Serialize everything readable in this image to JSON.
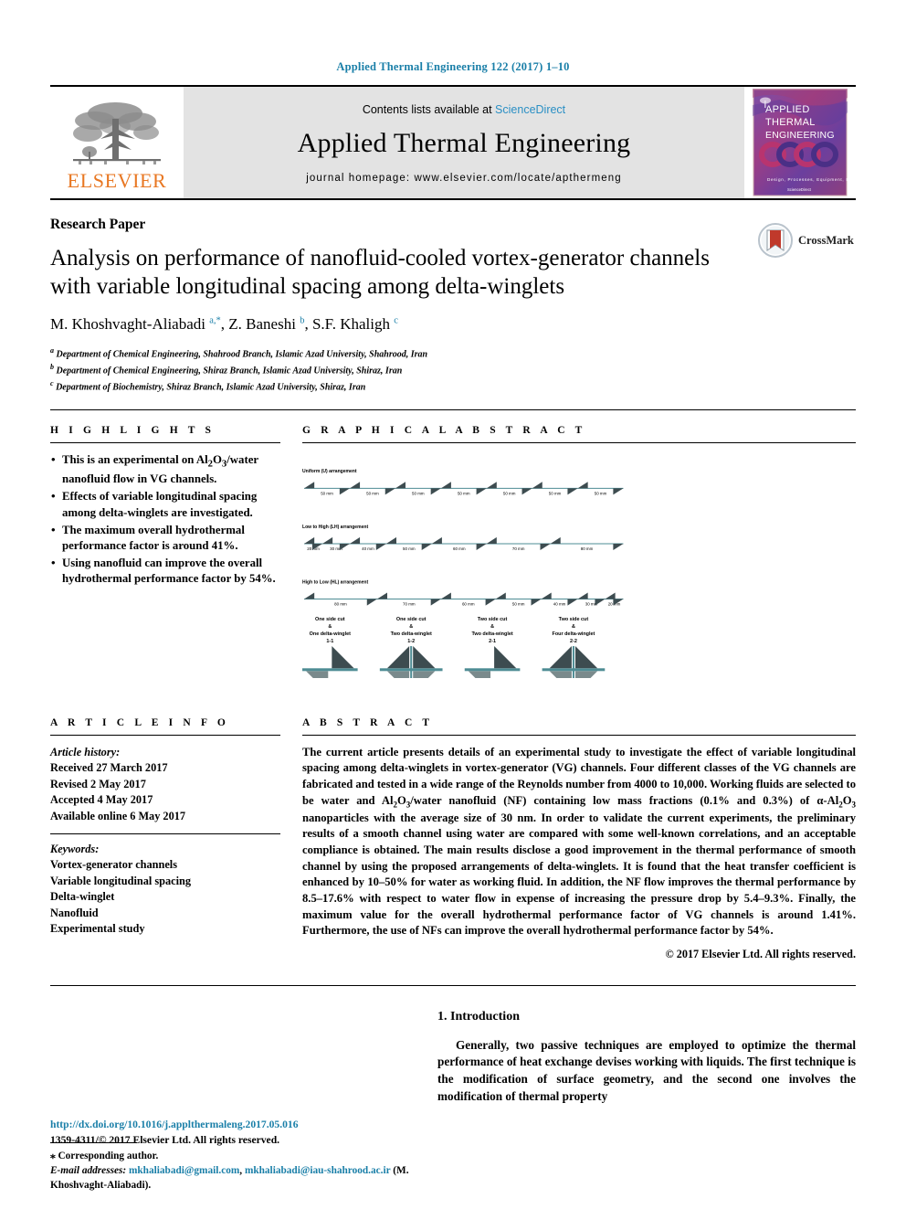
{
  "running_head": "Applied Thermal Engineering 122 (2017) 1–10",
  "masthead": {
    "publisher_name": "ELSEVIER",
    "publisher_logo_icon": "elsevier-tree-icon",
    "contents_prefix": "Contents lists available at ",
    "contents_link": "ScienceDirect",
    "journal_title": "Applied Thermal Engineering",
    "homepage": "journal homepage: www.elsevier.com/locate/apthermeng",
    "cover": {
      "line1": "APPLIED",
      "line2": "THERMAL",
      "line3": "ENGINEERING",
      "tagline": "Design, Processes, Equipment, Economics"
    }
  },
  "article": {
    "type": "Research Paper",
    "title": "Analysis on performance of nanofluid-cooled vortex-generator channels with variable longitudinal spacing among delta-winglets",
    "authors_html": "M. Khoshvaght-Aliabadi <sup>a,</sup><sup>*</sup>, Z. Baneshi <sup>b</sup>, S.F. Khaligh <sup>c</sup>",
    "affiliations": [
      "Department of Chemical Engineering, Shahrood Branch, Islamic Azad University, Shahrood, Iran",
      "Department of Chemical Engineering, Shiraz Branch, Islamic Azad University, Shiraz, Iran",
      "Department of Biochemistry, Shiraz Branch, Islamic Azad University, Shiraz, Iran"
    ],
    "affil_marks": [
      "a",
      "b",
      "c"
    ],
    "crossmark_label": "CrossMark",
    "crossmark_icon": "crossmark-icon"
  },
  "highlights": {
    "heading": "H I G H L I G H T S",
    "items": [
      "This is an experimental on Al2O3/water nanofluid flow in VG channels.",
      "Effects of variable longitudinal spacing among delta-winglets are investigated.",
      "The maximum overall hydrothermal performance factor is around 41%.",
      "Using nanofluid can improve the overall hydrothermal performance factor by 54%."
    ]
  },
  "graphical_abstract": {
    "heading": "G R A P H I C A L   A B S T R A C T",
    "rows": [
      {
        "label": "Uniform (U) arrangement",
        "spacings": [
          "50 mm",
          "50 mm",
          "50 mm",
          "50 mm",
          "50 mm",
          "50 mm",
          "50 mm"
        ]
      },
      {
        "label": "Low to High (LH) arrangement",
        "spacings": [
          "20 mm",
          "30 mm",
          "40 mm",
          "50 mm",
          "60 mm",
          "70 mm",
          "80 mm"
        ]
      },
      {
        "label": "High to Low (HL) arrangement",
        "spacings": [
          "80 mm",
          "70 mm",
          "60 mm",
          "50 mm",
          "40 mm",
          "30 mm",
          "20 mm"
        ]
      }
    ],
    "classes": [
      {
        "l1": "One side cut",
        "amp": "&",
        "l2": "One delta-winglet",
        "code": "1-1",
        "type": "1-1"
      },
      {
        "l1": "One side cut",
        "amp": "&",
        "l2": "Two delta-winglet",
        "code": "1-2",
        "type": "1-2"
      },
      {
        "l1": "Two side cut",
        "amp": "&",
        "l2": "Two delta-winglet",
        "code": "2-1",
        "type": "2-1"
      },
      {
        "l1": "Two side cut",
        "amp": "&",
        "l2": "Four delta-winglet",
        "code": "2-2",
        "type": "2-2"
      }
    ],
    "accent_color": "#4e8c94",
    "winglet_dark": "#3d4c50",
    "winglet_light": "#7a8a8c"
  },
  "article_info": {
    "heading": "A R T I C L E   I N F O",
    "history_label": "Article history:",
    "history": [
      "Received 27 March 2017",
      "Revised 2 May 2017",
      "Accepted 4 May 2017",
      "Available online 6 May 2017"
    ],
    "keywords_label": "Keywords:",
    "keywords": [
      "Vortex-generator channels",
      "Variable longitudinal spacing",
      "Delta-winglet",
      "Nanofluid",
      "Experimental study"
    ]
  },
  "abstract": {
    "heading": "A B S T R A C T",
    "paragraphs": [
      "The current article presents details of an experimental study to investigate the effect of variable longitudinal spacing among delta-winglets in vortex-generator (VG) channels. Four different classes of the VG channels are fabricated and tested in a wide range of the Reynolds number from 4000 to 10,000. Working fluids are selected to be water and Al2O3/water nanofluid (NF) containing low mass fractions (0.1% and 0.3%) of α-Al2O3 nanoparticles with the average size of 30 nm. In order to validate the current experiments, the preliminary results of a smooth channel using water are compared with some well-known correlations, and an acceptable compliance is obtained. The main results disclose a good improvement in the thermal performance of smooth channel by using the proposed arrangements of delta-winglets. It is found that the heat transfer coefficient is enhanced by 10–50% for water as working fluid. In addition, the NF flow improves the thermal performance by 8.5–17.6% with respect to water flow in expense of increasing the pressure drop by 5.4–9.3%. Finally, the maximum value for the overall hydrothermal performance factor of VG channels is around 1.41%. Furthermore, the use of NFs can improve the overall hydrothermal performance factor by 54%."
    ],
    "copyright": "© 2017 Elsevier Ltd. All rights reserved."
  },
  "introduction": {
    "heading": "1. Introduction",
    "paragraph": "Generally, two passive techniques are employed to optimize the thermal performance of heat exchange devises working with liquids. The first technique is the modification of surface geometry, and the second one involves the modification of thermal property"
  },
  "footnote": {
    "corresponding": "⁎ Corresponding author.",
    "email_label": "E-mail addresses:",
    "email1": "mkhaliabadi@gmail.com",
    "email_sep": ", ",
    "email2": "mkhaliabadi@iau-shahrood.ac.ir",
    "email_tail": " (M. Khoshvaght-Aliabadi)."
  },
  "footer": {
    "doi": "http://dx.doi.org/10.1016/j.applthermaleng.2017.05.016",
    "issn_line": "1359-4311/© 2017 Elsevier Ltd. All rights reserved."
  }
}
